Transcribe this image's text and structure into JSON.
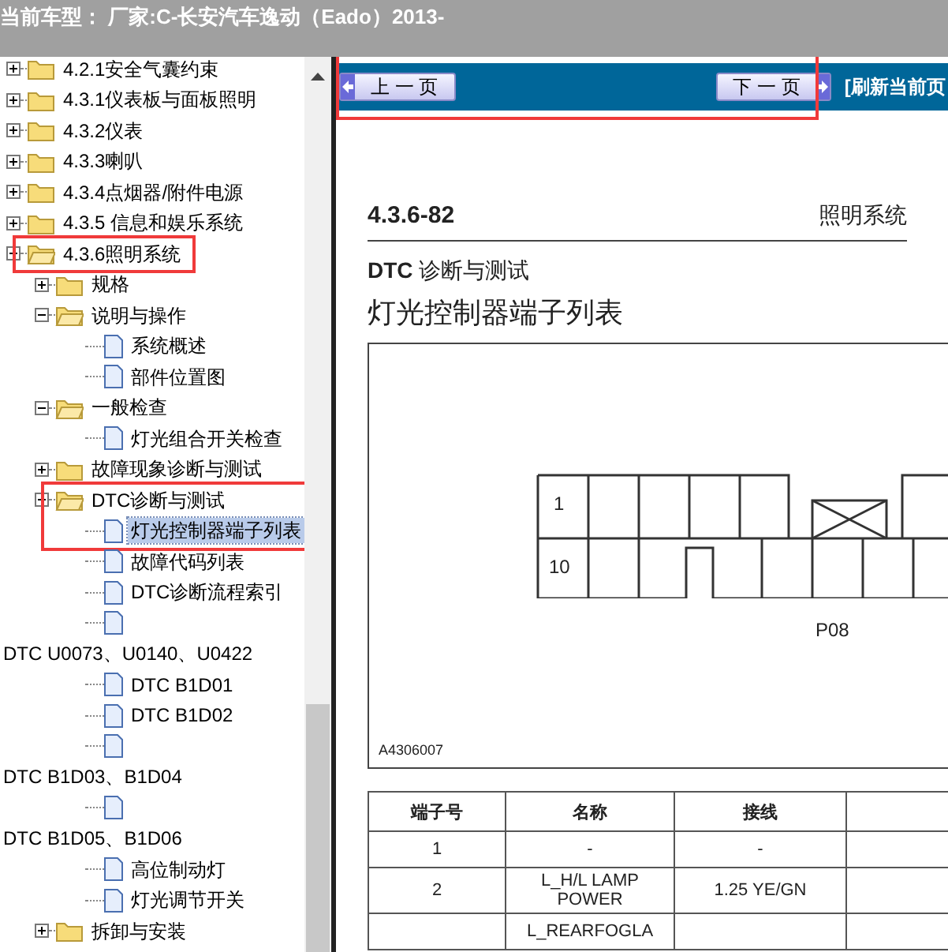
{
  "header": {
    "text": "当前车型： 厂家:C-长安汽车逸动（Eado）2013-"
  },
  "tree": [
    {
      "kind": "folder",
      "label": "4.2.1安全气囊约束",
      "expanded": false,
      "selected": false,
      "highlighted": false
    },
    {
      "kind": "folder",
      "label": "4.3.1仪表板与面板照明",
      "expanded": false,
      "selected": false,
      "highlighted": false
    },
    {
      "kind": "folder",
      "label": "4.3.2仪表",
      "expanded": false,
      "selected": false,
      "highlighted": false
    },
    {
      "kind": "folder",
      "label": "4.3.3喇叭",
      "expanded": false,
      "selected": false,
      "highlighted": false
    },
    {
      "kind": "folder",
      "label": "4.3.4点烟器/附件电源",
      "expanded": false,
      "selected": false,
      "highlighted": false
    },
    {
      "kind": "folder",
      "label": "4.3.5 信息和娱乐系统",
      "expanded": false,
      "selected": false,
      "highlighted": false
    },
    {
      "kind": "folder",
      "label": "4.3.6照明系统",
      "expanded": true,
      "selected": false,
      "highlighted": true,
      "children": [
        {
          "kind": "folder",
          "label": "规格",
          "expanded": false,
          "selected": false,
          "highlighted": false
        },
        {
          "kind": "folder",
          "label": "说明与操作",
          "expanded": true,
          "selected": false,
          "highlighted": false,
          "children": [
            {
              "kind": "doc",
              "label": "系统概述",
              "selected": false,
              "highlighted": false
            },
            {
              "kind": "doc",
              "label": "部件位置图",
              "selected": false,
              "highlighted": false
            }
          ]
        },
        {
          "kind": "folder",
          "label": "一般检查",
          "expanded": true,
          "selected": false,
          "highlighted": false,
          "children": [
            {
              "kind": "doc",
              "label": "灯光组合开关检查",
              "selected": false,
              "highlighted": false
            }
          ]
        },
        {
          "kind": "folder",
          "label": "故障现象诊断与测试",
          "expanded": false,
          "selected": false,
          "highlighted": false
        },
        {
          "kind": "folder",
          "label": "DTC诊断与测试",
          "expanded": true,
          "selected": false,
          "highlighted": true,
          "children": [
            {
              "kind": "doc",
              "label": "灯光控制器端子列表",
              "selected": true,
              "highlighted": true
            },
            {
              "kind": "doc",
              "label": "故障代码列表",
              "selected": false,
              "highlighted": false
            },
            {
              "kind": "doc",
              "label": "DTC诊断流程索引",
              "selected": false,
              "highlighted": false
            },
            {
              "kind": "doc"
            },
            {
              "kind": "stray",
              "label": "DTC U0073、U0140、U0422"
            },
            {
              "kind": "doc",
              "label": "DTC B1D01",
              "selected": false,
              "highlighted": false
            },
            {
              "kind": "doc",
              "label": "DTC B1D02",
              "selected": false,
              "highlighted": false
            },
            {
              "kind": "doc"
            },
            {
              "kind": "stray",
              "label": "DTC B1D03、B1D04"
            },
            {
              "kind": "doc"
            },
            {
              "kind": "stray",
              "label": "DTC B1D05、B1D06"
            },
            {
              "kind": "doc",
              "label": "高位制动灯",
              "selected": false,
              "highlighted": false
            },
            {
              "kind": "doc",
              "label": "灯光调节开关",
              "selected": false,
              "highlighted": false
            }
          ]
        },
        {
          "kind": "folder",
          "label": "拆卸与安装",
          "expanded": false,
          "selected": false,
          "highlighted": false
        }
      ]
    }
  ],
  "nav": {
    "highlighted": true,
    "prev": "上 一 页",
    "next": "下 一 页",
    "refresh": "[刷新当前页"
  },
  "page": {
    "section": "4.3.6-82",
    "chapter": "照明系统",
    "subtitle": "**DTC** 诊断与测试",
    "title": "灯光控制器端子列表",
    "connector": {
      "pin_first_row": "1",
      "pin_second_row": "10",
      "name": "P08",
      "figure_id": "A4306007"
    },
    "table": {
      "columns": [
        "端子号",
        "名称",
        "接线"
      ],
      "rows": [
        {
          "terminal": "1",
          "name": "-",
          "wiring": "-"
        },
        {
          "terminal": "2",
          "name": "L_H/L LAMP POWER",
          "wiring": "1.25 YE/GN"
        },
        {
          "name": "L_REARFOGLA"
        }
      ]
    }
  }
}
